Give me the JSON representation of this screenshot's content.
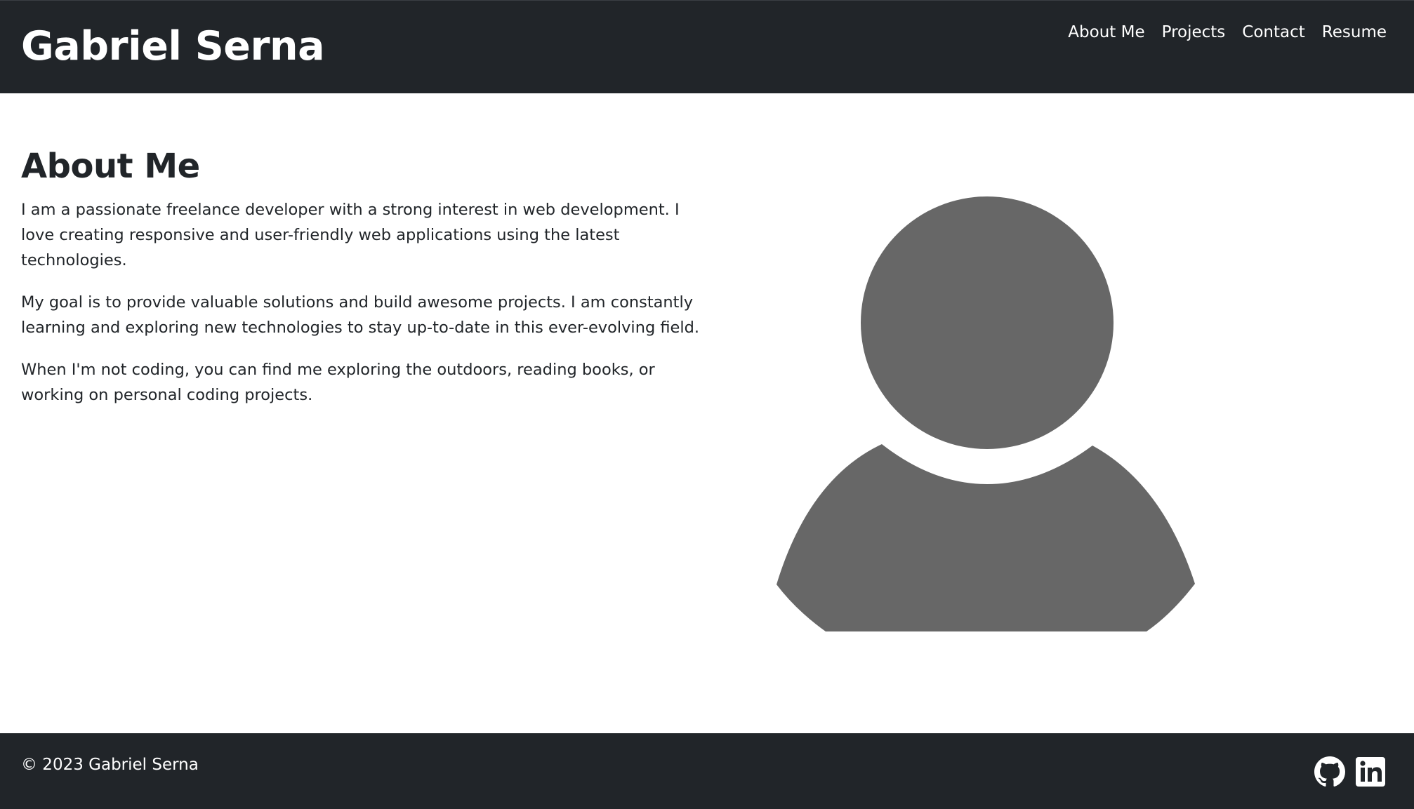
{
  "header": {
    "brand": "Gabriel Serna",
    "nav": [
      {
        "label": "About Me"
      },
      {
        "label": "Projects"
      },
      {
        "label": "Contact"
      },
      {
        "label": "Resume"
      }
    ]
  },
  "about": {
    "heading": "About Me",
    "paragraphs": [
      "I am a passionate freelance developer with a strong interest in web development. I love creating responsive and user-friendly web applications using the latest technologies.",
      "My goal is to provide valuable solutions and build awesome projects. I am constantly learning and exploring new technologies to stay up-to-date in this ever-evolving field.",
      "When I'm not coding, you can find me exploring the outdoors, reading books, or working on personal coding projects."
    ],
    "avatar_icon": "user-avatar-icon",
    "avatar_color": "#676767"
  },
  "footer": {
    "copyright": "© 2023 Gabriel Serna",
    "social": [
      {
        "icon": "github-icon"
      },
      {
        "icon": "linkedin-icon"
      }
    ]
  },
  "colors": {
    "dark": "#212529",
    "text": "#212529",
    "light_text": "#ffffff"
  }
}
